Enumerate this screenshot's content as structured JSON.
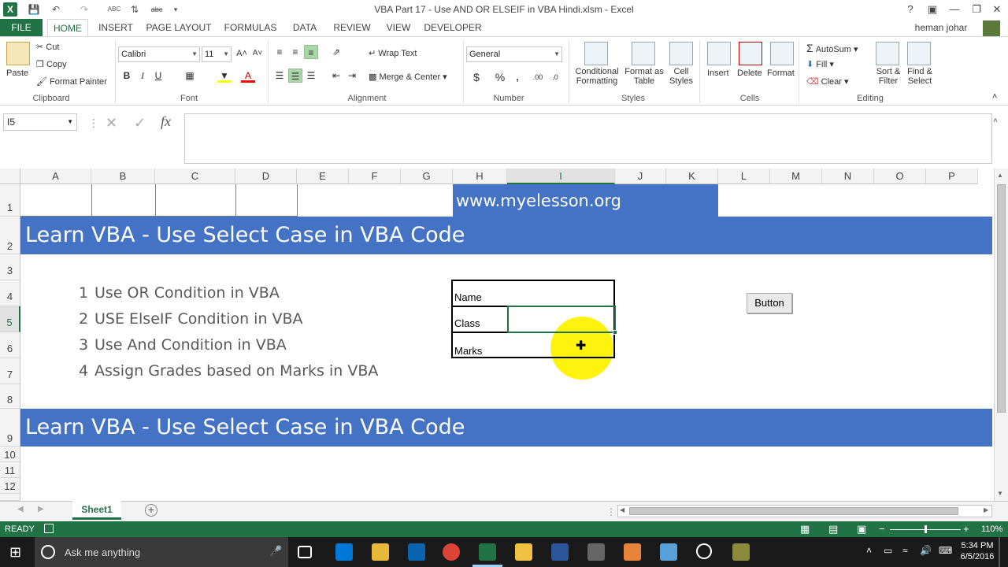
{
  "window": {
    "title": "VBA Part 17 -  Use AND OR ELSEIF in VBA Hindi.xlsm - Excel",
    "help": "?",
    "user": "heman johar"
  },
  "tabs": [
    "FILE",
    "HOME",
    "INSERT",
    "PAGE LAYOUT",
    "FORMULAS",
    "DATA",
    "REVIEW",
    "VIEW",
    "DEVELOPER"
  ],
  "ribbon": {
    "clipboard": {
      "label": "Clipboard",
      "paste": "Paste",
      "cut": "Cut",
      "copy": "Copy",
      "format_painter": "Format Painter"
    },
    "font": {
      "label": "Font",
      "name": "Calibri",
      "size": "11",
      "bold": "B",
      "italic": "I",
      "underline": "U"
    },
    "alignment": {
      "label": "Alignment",
      "wrap_text": "Wrap Text",
      "merge_center": "Merge & Center"
    },
    "number": {
      "label": "Number",
      "format": "General",
      "currency": "$",
      "percent": "%",
      "comma": ","
    },
    "styles": {
      "label": "Styles",
      "conditional_1": "Conditional",
      "conditional_2": "Formatting",
      "format_table_1": "Format as",
      "format_table_2": "Table",
      "cell_styles_1": "Cell",
      "cell_styles_2": "Styles"
    },
    "cells": {
      "label": "Cells",
      "insert": "Insert",
      "delete": "Delete",
      "format": "Format"
    },
    "editing": {
      "label": "Editing",
      "autosum": "AutoSum",
      "fill": "Fill",
      "clear": "Clear",
      "sort_1": "Sort &",
      "sort_2": "Filter",
      "find_1": "Find &",
      "find_2": "Select"
    }
  },
  "formula_bar": {
    "name_box": "I5",
    "fx": "fx",
    "value": ""
  },
  "columns": [
    "A",
    "B",
    "C",
    "D",
    "E",
    "F",
    "G",
    "H",
    "I",
    "J",
    "K",
    "L",
    "M",
    "N",
    "O",
    "P"
  ],
  "rows": [
    "1",
    "2",
    "3",
    "4",
    "5",
    "6",
    "7",
    "8",
    "9",
    "10",
    "11",
    "12"
  ],
  "selected": {
    "column": "I",
    "row": "5"
  },
  "sheet": {
    "url": "www.myelesson.org",
    "banner_top": "Learn VBA - Use Select Case in VBA Code",
    "banner_bottom": "Learn VBA - Use Select Case in VBA Code",
    "topics": [
      {
        "num": "1",
        "text": "Use OR Condition in VBA"
      },
      {
        "num": "2",
        "text": "USE ElseIF Condition in VBA"
      },
      {
        "num": "3",
        "text": "Use And Condition in VBA"
      },
      {
        "num": "4",
        "text": "Assign Grades based on Marks in VBA"
      }
    ],
    "form": {
      "name_label": "Name",
      "class_label": "Class",
      "marks_label": "Marks"
    },
    "button_label": "Button"
  },
  "sheet_tabs": {
    "active": "Sheet1"
  },
  "status": {
    "ready": "READY",
    "zoom": "110%"
  },
  "taskbar": {
    "search_placeholder": "Ask me anything",
    "time": "5:34 PM",
    "date": "6/5/2016"
  },
  "colors": {
    "excel_green": "#217346",
    "banner_blue": "#4472c4",
    "highlight_yellow": "#fff200"
  }
}
